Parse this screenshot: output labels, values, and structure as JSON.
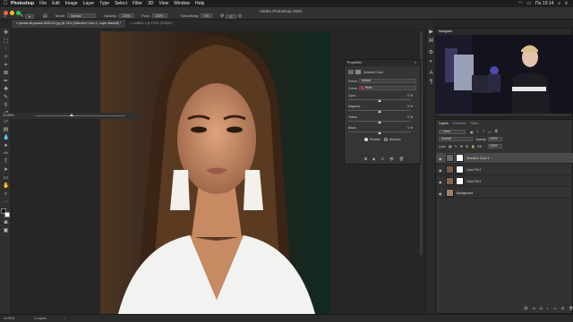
{
  "menubar": {
    "apple": "",
    "items": [
      "Photoshop",
      "File",
      "Edit",
      "Image",
      "Layer",
      "Type",
      "Select",
      "Filter",
      "3D",
      "View",
      "Window",
      "Help"
    ],
    "clock": "Пн 13:14"
  },
  "window_title": "Adobe Photoshop 2020",
  "options": {
    "mode_label": "Mode:",
    "mode_value": "Normal",
    "opacity_label": "Opacity:",
    "opacity_value": "100%",
    "flow_label": "Flow:",
    "flow_value": "100%",
    "smoothing_label": "Smoothing:",
    "smoothing_value": "0%",
    "angle_value": "0°"
  },
  "tabs": [
    {
      "label": "pexels-ali-pazani-2625122.jpg @ 15% (Selective Color 1, Layer Mask/8) *",
      "active": true
    },
    {
      "label": "Untitled-1 @ 100% (RGB/8) *",
      "active": false
    }
  ],
  "properties": {
    "title": "Properties",
    "layer_name": "Selective Color",
    "preset_label": "Preset:",
    "preset_value": "Default",
    "colors_label": "Colors:",
    "colors_value": "Reds",
    "sliders": [
      {
        "label": "Cyan:",
        "value": "0",
        "unit": "%",
        "pos": 0.5
      },
      {
        "label": "Magenta:",
        "value": "0",
        "unit": "%",
        "pos": 0.5
      },
      {
        "label": "Yellow:",
        "value": "0",
        "unit": "%",
        "pos": 0.5
      },
      {
        "label": "Black:",
        "value": "0",
        "unit": "%",
        "pos": 0.5
      }
    ],
    "method_relative": "Relative",
    "method_absolute": "Absolute"
  },
  "navigator": {
    "title": "Navigator",
    "zoom": "14.99%"
  },
  "layers_panel": {
    "tabs": [
      "Layers",
      "Channels",
      "Paths"
    ],
    "kind_label": "Kind",
    "blend_mode": "Normal",
    "opacity_label": "Opacity:",
    "opacity_value": "100%",
    "lock_label": "Lock:",
    "fill_label": "Fill:",
    "fill_value": "100%",
    "layers": [
      {
        "name": "Selective Color 1",
        "selected": true,
        "thumb": "#6b6b6b",
        "has_mask": true
      },
      {
        "name": "Color Fill 2",
        "selected": false,
        "thumb": "#7b5a44",
        "has_mask": true
      },
      {
        "name": "Color Fill 1",
        "selected": false,
        "thumb": "#8a6450",
        "has_mask": true
      },
      {
        "name": "Background",
        "selected": false,
        "thumb": "#a08064",
        "has_mask": false
      }
    ]
  },
  "status": {
    "zoom": "14.99%",
    "doc_info": "4 Layers"
  },
  "colors": {
    "accent": "#1f6fd0",
    "panel": "#323232"
  }
}
